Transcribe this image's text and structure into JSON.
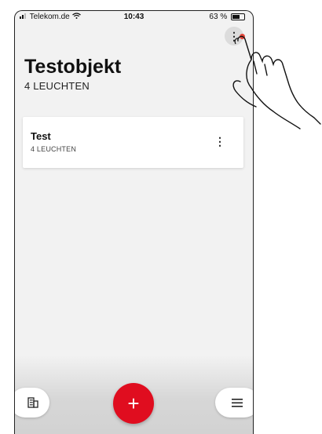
{
  "status_bar": {
    "carrier": "Telekom.de",
    "time": "10:43",
    "battery": "63 %"
  },
  "header": {
    "title": "Testobjekt",
    "subtitle": "4 LEUCHTEN"
  },
  "cards": [
    {
      "title": "Test",
      "subtitle": "4 LEUCHTEN"
    }
  ],
  "icons": {
    "menu_top": "more-vert-icon",
    "card_menu": "more-vert-icon",
    "left_nav": "building-icon",
    "add": "plus-icon",
    "right_nav": "hamburger-menu-icon",
    "signal": "signal-icon",
    "wifi": "wifi-icon",
    "battery": "battery-icon"
  },
  "colors": {
    "accent": "#e00d1f",
    "highlight_dot": "#e4473b",
    "background": "#f2f2f2"
  }
}
